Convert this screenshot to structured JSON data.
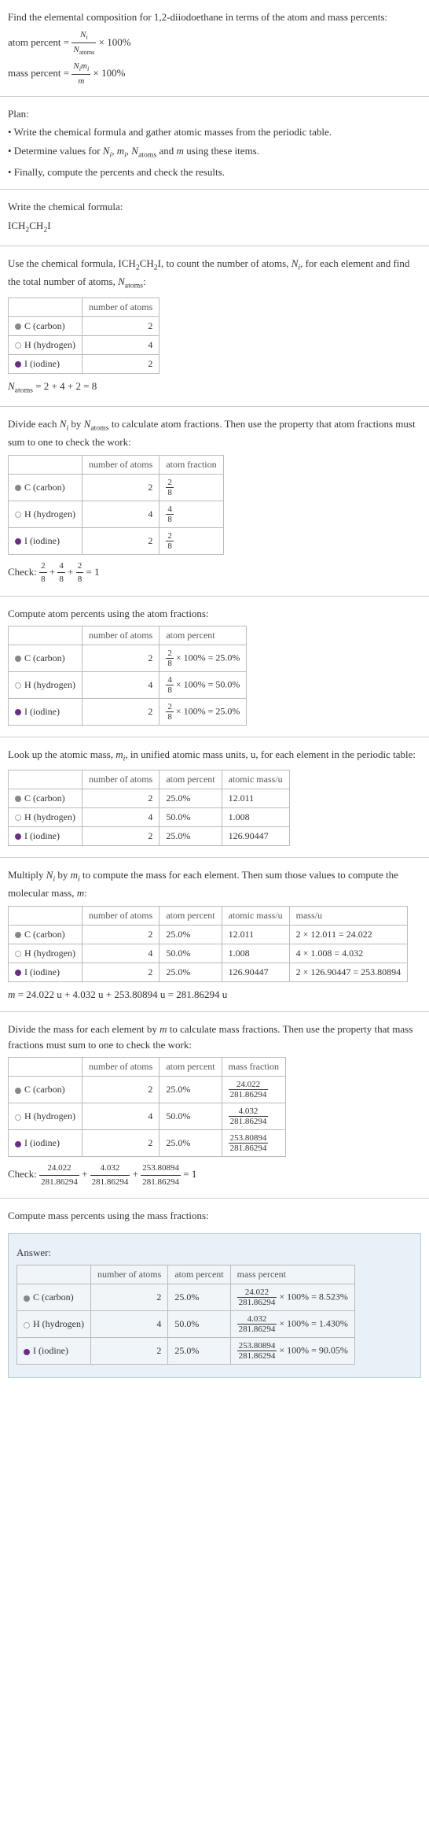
{
  "intro": {
    "line1": "Find the elemental composition for 1,2-diiodoethane in terms of the atom and mass percents:",
    "atom_percent_label": "atom percent",
    "mass_percent_label": "mass percent",
    "equals": " = ",
    "times100": " × 100%",
    "frac_ni": "N",
    "frac_ni_sub": "i",
    "frac_natoms": "N",
    "frac_natoms_sub": "atoms",
    "frac_nimi": "N",
    "frac_nimi_sub1": "i",
    "frac_nimi_m": "m",
    "frac_nimi_sub2": "i",
    "frac_m": "m"
  },
  "plan": {
    "title": "Plan:",
    "b1": "• Write the chemical formula and gather atomic masses from the periodic table.",
    "b2_pre": "• Determine values for ",
    "b2_n": "N",
    "b2_i": "i",
    "b2_c1": ", ",
    "b2_m": "m",
    "b2_c2": ", ",
    "b2_natoms": "N",
    "b2_atoms": "atoms",
    "b2_and": " and ",
    "b2_m2": "m",
    "b2_post": " using these items.",
    "b3": "• Finally, compute the percents and check the results."
  },
  "formula": {
    "title": "Write the chemical formula:",
    "text": "ICH",
    "sub1": "2",
    "text2": "CH",
    "sub2": "2",
    "text3": "I"
  },
  "count": {
    "line_pre": "Use the chemical formula, ICH",
    "s1": "2",
    "mid1": "CH",
    "s2": "2",
    "mid2": "I, to count the number of atoms, ",
    "ni": "N",
    "ni_sub": "i",
    "mid3": ", for each element and find the total number of atoms, ",
    "na": "N",
    "na_sub": "atoms",
    "colon": ":",
    "h_empty": "",
    "h_num": "number of atoms",
    "c_label": "C (carbon)",
    "c_n": "2",
    "h_label": "H (hydrogen)",
    "h_n": "4",
    "i_label": "I (iodine)",
    "i_n": "2",
    "sum_pre": "N",
    "sum_sub": "atoms",
    "sum_eq": " = 2 + 4 + 2 = 8"
  },
  "atomfrac": {
    "line_pre": "Divide each ",
    "ni": "N",
    "ni_sub": "i",
    "mid": " by ",
    "na": "N",
    "na_sub": "atoms",
    "post": " to calculate atom fractions. Then use the property that atom fractions must sum to one to check the work:",
    "h1": "number of atoms",
    "h2": "atom fraction",
    "c_n": "2",
    "c_num": "2",
    "c_den": "8",
    "h_n": "4",
    "h_num": "4",
    "h_den": "8",
    "i_n": "2",
    "i_num": "2",
    "i_den": "8",
    "check_label": "Check: ",
    "check_f1n": "2",
    "check_f1d": "8",
    "check_plus": " + ",
    "check_f2n": "4",
    "check_f2d": "8",
    "check_f3n": "2",
    "check_f3d": "8",
    "check_eq": " = 1"
  },
  "atompct": {
    "title": "Compute atom percents using the atom fractions:",
    "h1": "number of atoms",
    "h2": "atom percent",
    "c_n": "2",
    "c_num": "2",
    "c_den": "8",
    "c_res": " × 100% = 25.0%",
    "h_n": "4",
    "h_num": "4",
    "h_den": "8",
    "h_res": " × 100% = 50.0%",
    "i_n": "2",
    "i_num": "2",
    "i_den": "8",
    "i_res": " × 100% = 25.0%"
  },
  "atomicmass": {
    "line_pre": "Look up the atomic mass, ",
    "m": "m",
    "m_sub": "i",
    "post": ", in unified atomic mass units, u, for each element in the periodic table:",
    "h1": "number of atoms",
    "h2": "atom percent",
    "h3": "atomic mass/u",
    "c_n": "2",
    "c_p": "25.0%",
    "c_m": "12.011",
    "h_n": "4",
    "h_p": "50.0%",
    "h_m": "1.008",
    "i_n": "2",
    "i_p": "25.0%",
    "i_m": "126.90447"
  },
  "massmult": {
    "line_pre": "Multiply ",
    "ni": "N",
    "ni_sub": "i",
    "by": " by ",
    "mi": "m",
    "mi_sub": "i",
    "mid": " to compute the mass for each element. Then sum those values to compute the molecular mass, ",
    "m": "m",
    "colon": ":",
    "h1": "number of atoms",
    "h2": "atom percent",
    "h3": "atomic mass/u",
    "h4": "mass/u",
    "c_n": "2",
    "c_p": "25.0%",
    "c_m": "12.011",
    "c_calc": "2 × 12.011 = 24.022",
    "h_n": "4",
    "h_p": "50.0%",
    "h_m": "1.008",
    "h_calc": "4 × 1.008 = 4.032",
    "i_n": "2",
    "i_p": "25.0%",
    "i_m": "126.90447",
    "i_calc": "2 × 126.90447 = 253.80894",
    "sum_m": "m",
    "sum_eq": " = 24.022 u + 4.032 u + 253.80894 u = 281.86294 u"
  },
  "massfrac": {
    "line_pre": "Divide the mass for each element by ",
    "m": "m",
    "post": " to calculate mass fractions. Then use the property that mass fractions must sum to one to check the work:",
    "h1": "number of atoms",
    "h2": "atom percent",
    "h3": "mass fraction",
    "c_n": "2",
    "c_p": "25.0%",
    "c_num": "24.022",
    "c_den": "281.86294",
    "h_n": "4",
    "h_p": "50.0%",
    "h_num": "4.032",
    "h_den": "281.86294",
    "i_n": "2",
    "i_p": "25.0%",
    "i_num": "253.80894",
    "i_den": "281.86294",
    "check_label": "Check: ",
    "check_f1n": "24.022",
    "check_f1d": "281.86294",
    "check_plus": " + ",
    "check_f2n": "4.032",
    "check_f2d": "281.86294",
    "check_f3n": "253.80894",
    "check_f3d": "281.86294",
    "check_eq": " = 1"
  },
  "masspct": {
    "title": "Compute mass percents using the mass fractions:"
  },
  "answer": {
    "title": "Answer:",
    "h1": "number of atoms",
    "h2": "atom percent",
    "h3": "mass percent",
    "c_n": "2",
    "c_p": "25.0%",
    "c_num": "24.022",
    "c_den": "281.86294",
    "c_res": " × 100% = 8.523%",
    "h_n": "4",
    "h_p": "50.0%",
    "h_num": "4.032",
    "h_den": "281.86294",
    "h_res": " × 100% = 1.430%",
    "i_n": "2",
    "i_p": "25.0%",
    "i_num": "253.80894",
    "i_den": "281.86294",
    "i_res": " × 100% = 90.05%"
  },
  "elements": {
    "c": "C (carbon)",
    "h": "H (hydrogen)",
    "i": "I (iodine)"
  }
}
